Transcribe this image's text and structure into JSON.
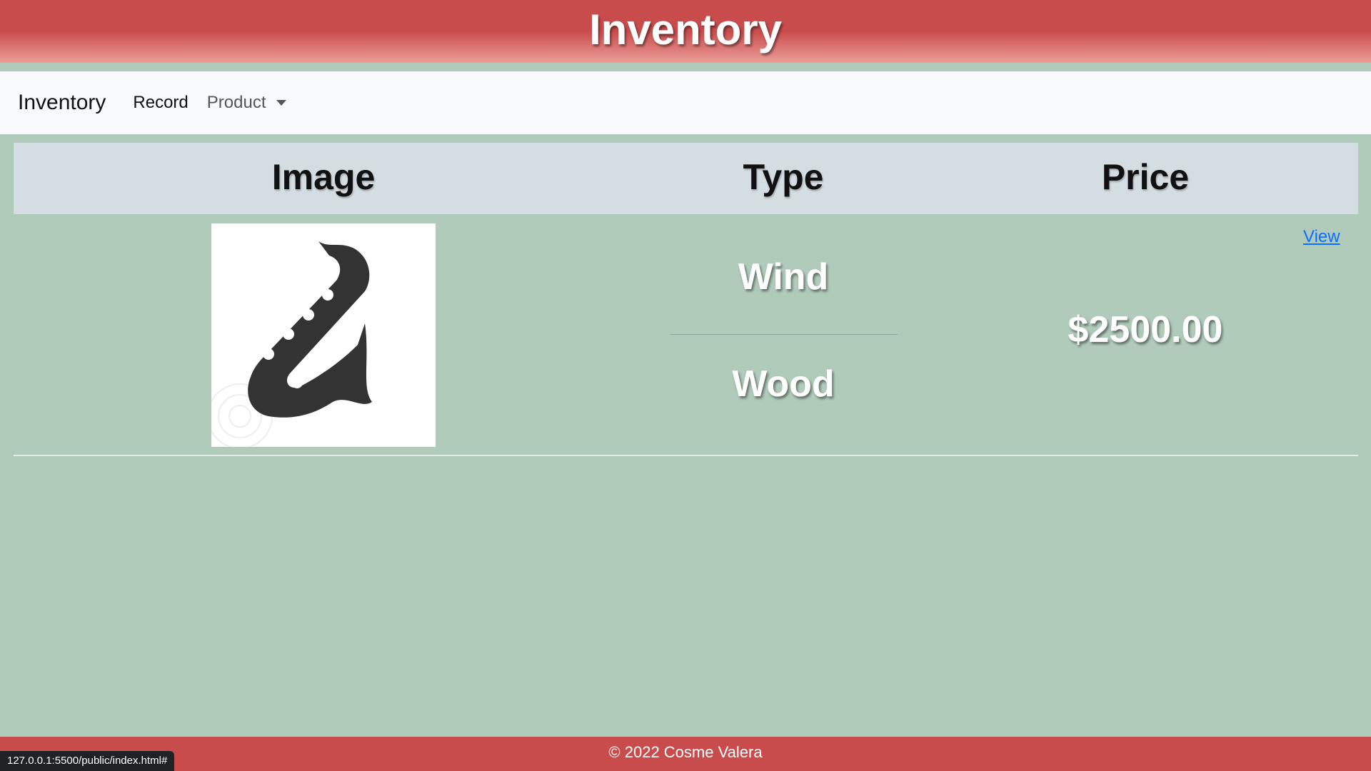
{
  "header": {
    "title": "Inventory"
  },
  "navbar": {
    "brand": "Inventory",
    "links": [
      {
        "label": "Record"
      },
      {
        "label": "Product"
      }
    ]
  },
  "table": {
    "columns": [
      "Image",
      "Type",
      "Price"
    ],
    "rows": [
      {
        "image": "saxophone-icon",
        "type": "Wind",
        "material": "Wood",
        "price": "$2500.00",
        "action": "View"
      }
    ]
  },
  "footer": {
    "text": "© 2022 Cosme Valera"
  },
  "status_bar": {
    "url": "127.0.0.1:5500/public/index.html#"
  }
}
